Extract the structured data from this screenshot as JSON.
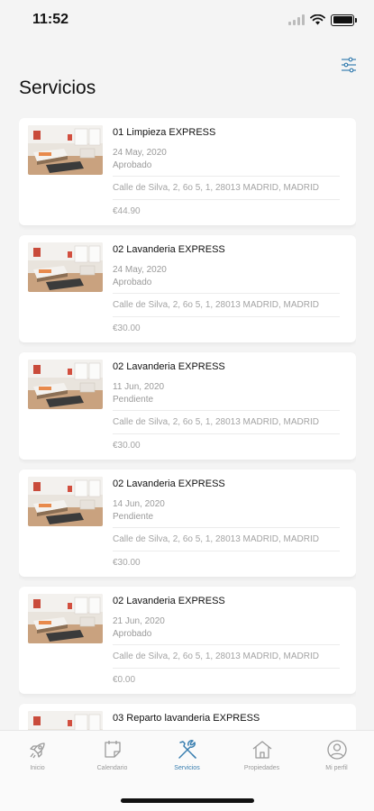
{
  "status_bar": {
    "time": "11:52"
  },
  "header": {
    "title": "Servicios",
    "filter_icon": "filter-sliders-icon"
  },
  "services": [
    {
      "title": "01 Limpieza EXPRESS",
      "date": "24 May, 2020",
      "status": "Aprobado",
      "address": "Calle de Silva, 2, 6o 5, 1, 28013 MADRID, MADRID",
      "price": "€44.90"
    },
    {
      "title": "02 Lavanderia EXPRESS",
      "date": "24 May, 2020",
      "status": "Aprobado",
      "address": "Calle de Silva, 2, 6o 5, 1, 28013 MADRID, MADRID",
      "price": "€30.00"
    },
    {
      "title": "02 Lavanderia EXPRESS",
      "date": "11 Jun, 2020",
      "status": "Pendiente",
      "address": "Calle de Silva, 2, 6o 5, 1, 28013 MADRID, MADRID",
      "price": "€30.00"
    },
    {
      "title": "02 Lavanderia EXPRESS",
      "date": "14 Jun, 2020",
      "status": "Pendiente",
      "address": "Calle de Silva, 2, 6o 5, 1, 28013 MADRID, MADRID",
      "price": "€30.00"
    },
    {
      "title": "02 Lavanderia EXPRESS",
      "date": "21 Jun, 2020",
      "status": "Aprobado",
      "address": "Calle de Silva, 2, 6o 5, 1, 28013 MADRID, MADRID",
      "price": "€0.00"
    },
    {
      "title": "03 Reparto lavanderia EXPRESS",
      "date": "",
      "status": "",
      "address": "",
      "price": ""
    }
  ],
  "tab_bar": {
    "items": [
      {
        "label": "Inicio",
        "icon": "rocket-icon"
      },
      {
        "label": "Calendario",
        "icon": "calendar-icon"
      },
      {
        "label": "Servicios",
        "icon": "tools-icon"
      },
      {
        "label": "Propiedades",
        "icon": "house-icon"
      },
      {
        "label": "Mi perfil",
        "icon": "profile-icon"
      }
    ],
    "active_index": 2
  },
  "colors": {
    "accent": "#3a7fb0",
    "inactive": "#9a9a9a",
    "background": "#f4f4f4",
    "card": "#ffffff"
  }
}
